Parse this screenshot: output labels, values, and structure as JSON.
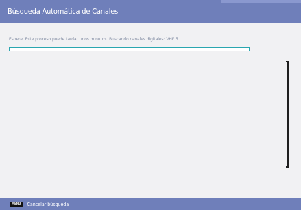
{
  "header": {
    "title": "Búsqueda Automática de Canales"
  },
  "status": {
    "text": "Espere. Este proceso puede tardar unos minutos. Buscando canales digitales: VHF 5"
  },
  "progress": {
    "value_percent": 0
  },
  "footer": {
    "key_label": "MENU",
    "action_label": "Cancelar búsqueda"
  },
  "colors": {
    "header_bg": "#6f7fba",
    "content_bg": "#f1f1f3",
    "accent": "#2aa6b0",
    "status_text": "#7f8aa1"
  }
}
